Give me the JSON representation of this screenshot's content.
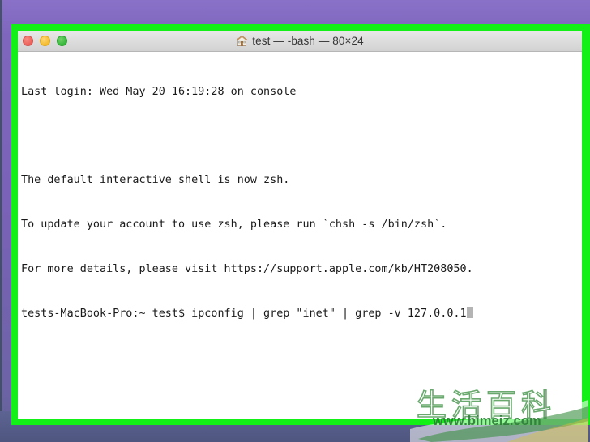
{
  "desktop": {
    "background_color": "#7a62b8",
    "bottom_band_color": "#545b86"
  },
  "window": {
    "border_color": "#13f018",
    "titlebar": {
      "icon": "house-icon",
      "title": "test — -bash — 80×24",
      "controls": [
        {
          "name": "close",
          "color": "#e9615a"
        },
        {
          "name": "minimize",
          "color": "#f3bb2d"
        },
        {
          "name": "maximize",
          "color": "#35b63a"
        }
      ]
    },
    "terminal": {
      "columns": 80,
      "rows": 24,
      "background_color": "#ffffff",
      "text_color": "#1a1a1a",
      "cursor_color": "#b4b4b4",
      "lines": [
        "Last login: Wed May 20 16:19:28 on console",
        "",
        "The default interactive shell is now zsh.",
        "To update your account to use zsh, please run `chsh -s /bin/zsh`.",
        "For more details, please visit https://support.apple.com/kb/HT208050.",
        "tests-MacBook-Pro:~ test$ ipconfig | grep \"inet\" | grep -v 127.0.0.1"
      ],
      "prompt_line_index": 5
    }
  },
  "watermark": {
    "characters": "生活百科",
    "url": "www.bimeiz.com",
    "stroke_color": "#3f9246",
    "url_color": "#2f7d3a"
  }
}
